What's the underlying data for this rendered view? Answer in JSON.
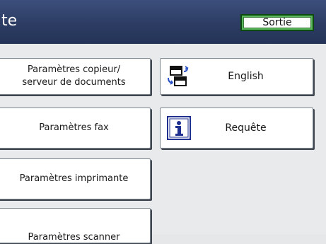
{
  "header": {
    "title": "te",
    "exit_label": "Sortie"
  },
  "left_buttons": [
    {
      "label_line1": "Paramètres copieur/",
      "label_line2": "serveur de documents"
    },
    {
      "label": "Paramètres fax"
    },
    {
      "label": "Paramètres imprimante"
    },
    {
      "label": "Paramètres scanner"
    }
  ],
  "right_buttons": [
    {
      "label": "English",
      "icon": "language-switch-icon"
    },
    {
      "label": "Requête",
      "icon": "info-icon"
    }
  ],
  "colors": {
    "header": "#2c3c63",
    "exit_border": "#5cb85c",
    "info_icon": "#1f2f8f"
  }
}
